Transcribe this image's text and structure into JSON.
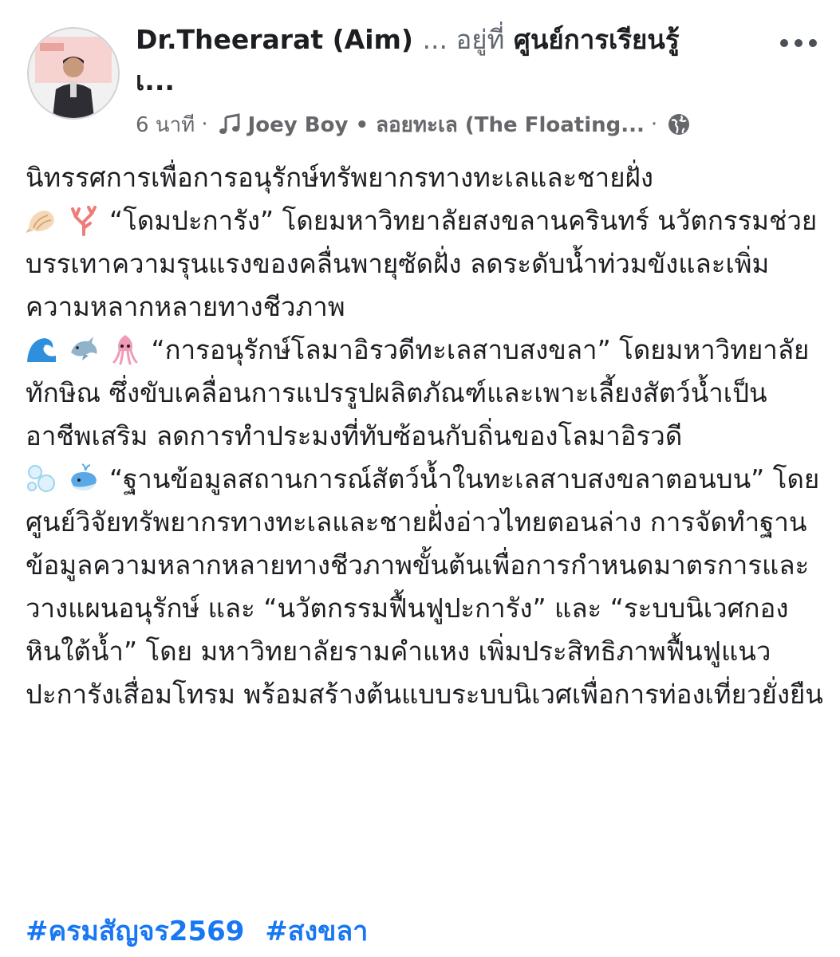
{
  "post": {
    "author_name": "Dr.Theerarat (Aim)",
    "author_suffix": "... อยู่ที่",
    "location": "ศูนย์การเรียนรู้",
    "location_cont": "เ...",
    "timestamp": "6 นาที",
    "meta_sep": "·",
    "music_label": "Joey Boy • ลอยทะเล (The Floating...",
    "meta_sep2": "·"
  },
  "icons": {
    "avatar": "profile-photo",
    "more": "more-options-icon",
    "music": "music-note-icon",
    "audience": "globe-icon",
    "emoji_1": "shell-emoji",
    "emoji_2": "coral-emoji",
    "emoji_3": "wave-emoji",
    "emoji_4": "dolphin-emoji",
    "emoji_5": "squid-emoji",
    "emoji_6": "bubbles-emoji",
    "emoji_7": "whale-emoji"
  },
  "body": {
    "line1": "นิทรรศการเพื่อการอนุรักษ์ทรัพยากรทางทะเลและชายฝั่ง",
    "p2": "“โดมปะการัง” โดยมหาวิทยาลัยสงขลานครินทร์ นวัตกรรมช่วยบรรเทาความรุนแรงของคลื่นพายุซัดฝั่ง ลดระดับน้ำท่วมขังและเพิ่มความหลากหลายทางชีวภาพ",
    "p3": "“การอนุรักษ์โลมาอิรวดีทะเลสาบสงขลา” โดยมหาวิทยาลัยทักษิณ ซึ่งขับเคลื่อนการแปรรูปผลิตภัณฑ์และเพาะเลี้ยงสัตว์น้ำเป็นอาชีพเสริม ลดการทำประมงที่ทับซ้อนกับถิ่นของโลมาอิรวดี",
    "p4": "“ฐานข้อมูลสถานการณ์สัตว์น้ำในทะเลสาบสงขลาตอนบน” โดย ศูนย์วิจัยทรัพยากรทางทะเลและชายฝั่งอ่าวไทยตอนล่าง การจัดทำฐานข้อมูลความหลากหลายทางชีวภาพขั้นต้นเพื่อการกำหนดมาตรการและวางแผนอนุรักษ์ และ “นวัตกรรมฟื้นฟูปะการัง” และ “ระบบนิเวศกองหินใต้น้ำ” โดย มหาวิทยาลัยรามคำแหง เพิ่มประสิทธิภาพฟื้นฟูแนวปะการังเสื่อมโทรม พร้อมสร้างต้นแบบระบบนิเวศเพื่อการท่องเที่ยวยั่งยืน"
  },
  "hashtags": [
    "#ครมสัญจร2569",
    "#สงขลา"
  ],
  "colors": {
    "link": "#1877f2",
    "text": "#1c1e21",
    "meta": "#65676b"
  }
}
